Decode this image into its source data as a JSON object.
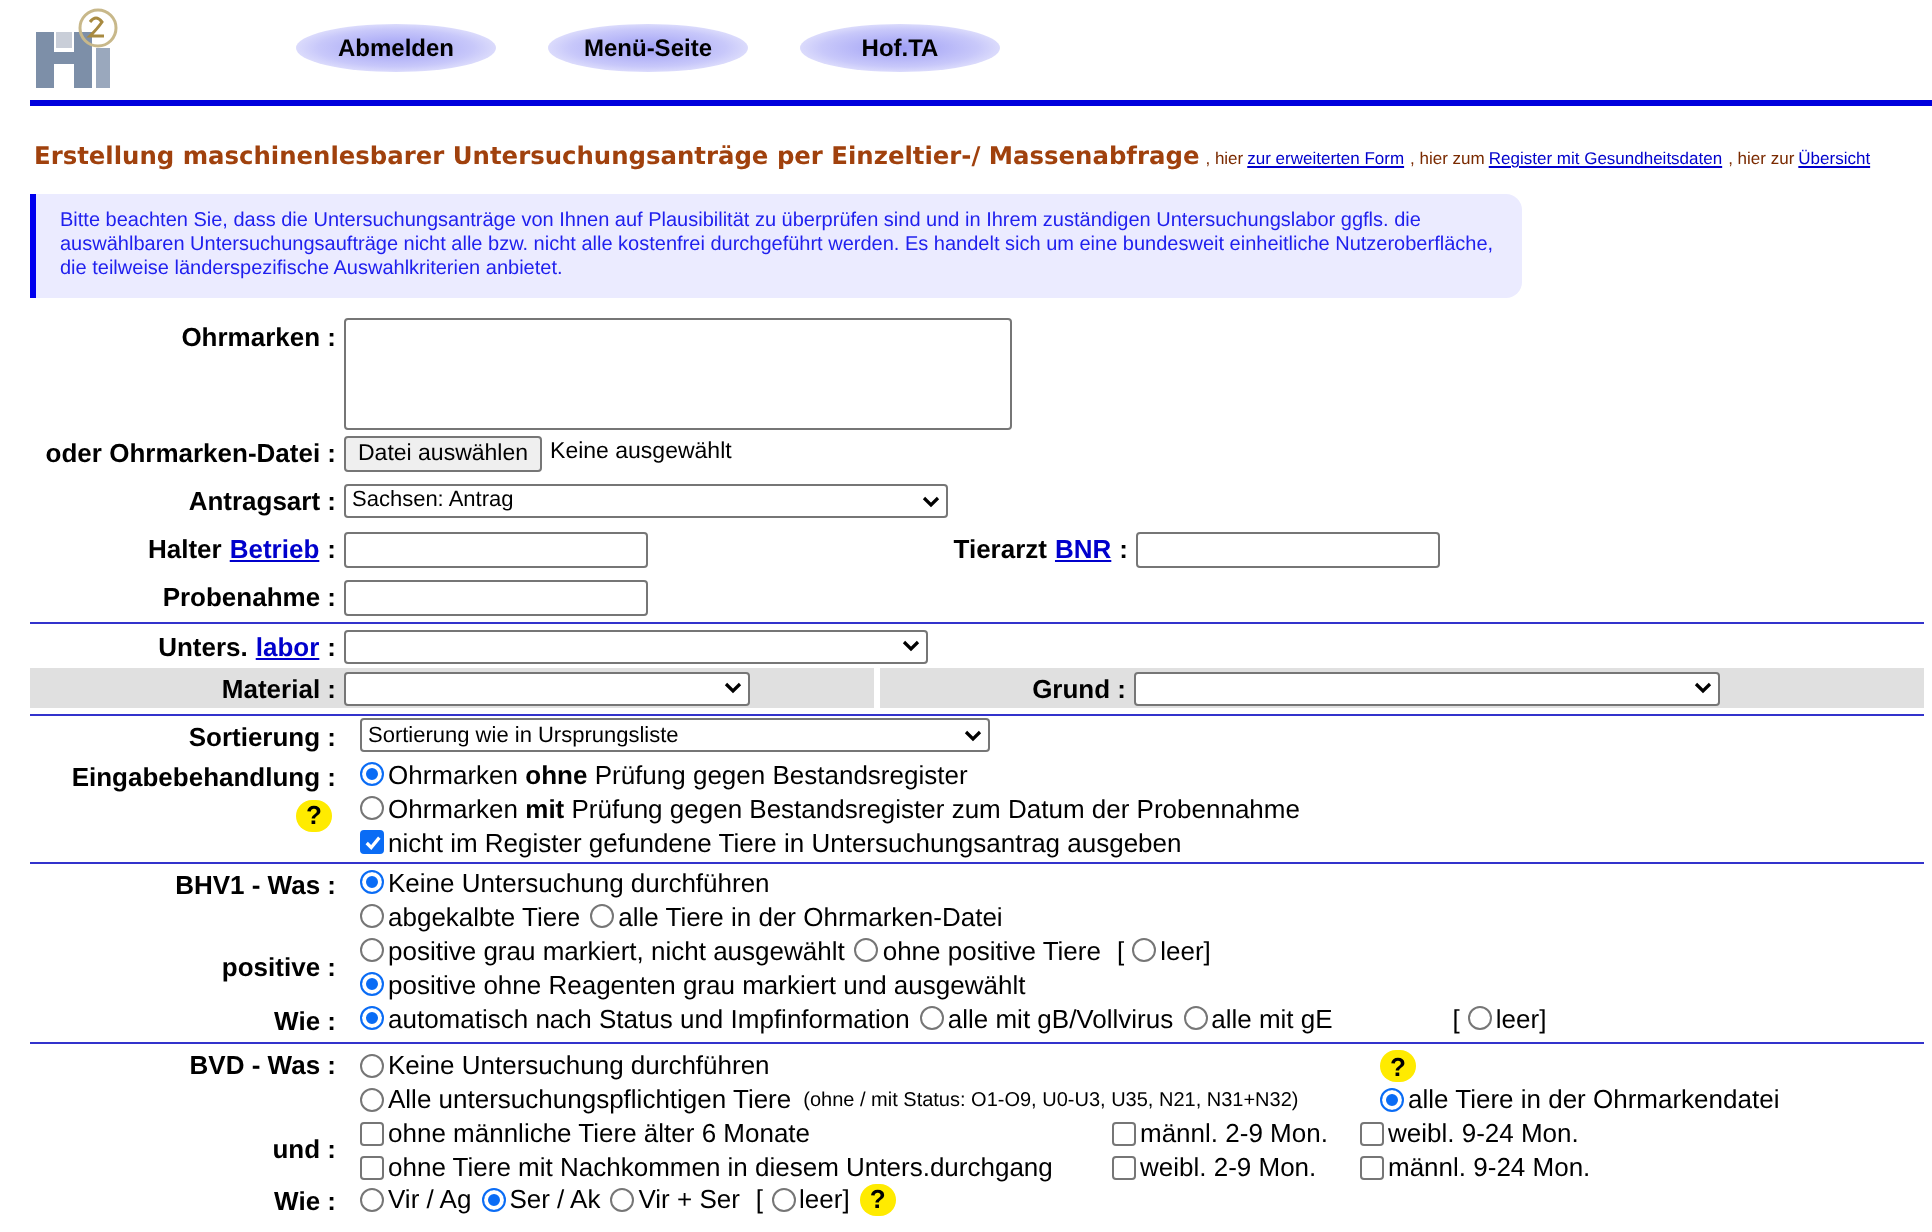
{
  "nav": [
    "Abmelden",
    "Menü-Seite",
    "Hof.TA"
  ],
  "title": "Erstellung maschinenlesbarer Untersuchungsanträge per Einzeltier-/ Massenabfrage",
  "title_links": [
    {
      "prefix": ", hier",
      "link": "zur erweiterten Form"
    },
    {
      "prefix": ", hier zum",
      "link": "Register mit Gesundheitsdaten"
    },
    {
      "prefix": ", hier zur",
      "link": "Übersicht"
    }
  ],
  "notice": "Bitte beachten Sie, dass die Untersuchungsanträge von Ihnen auf Plausibilität zu überprüfen sind und in Ihrem zuständigen Untersuchungslabor ggfls. die auswählbaren Untersuchungsaufträge nicht alle bzw. nicht alle kostenfrei durchgeführt werden. Es handelt sich um eine bundesweit einheitliche Nutzeroberfläche, die teilweise länderspezifische Auswahlkriterien anbietet.",
  "ohrmarken": {
    "label": "Ohrmarken :"
  },
  "datei": {
    "label": "oder Ohrmarken-Datei :",
    "button": "Datei auswählen",
    "status": "Keine ausgewählt"
  },
  "antragsart": {
    "label": "Antragsart :",
    "value": "Sachsen: Antrag"
  },
  "halter": {
    "label": "Halter",
    "link": "Betrieb",
    "suffix": ":"
  },
  "tierarzt": {
    "label": "Tierarzt",
    "link": "BNR",
    "suffix": ":"
  },
  "probenahme": {
    "label": "Probenahme :"
  },
  "labor": {
    "label": "Unters.",
    "link": "labor",
    "suffix": ":"
  },
  "material": {
    "label": "Material :"
  },
  "grund": {
    "label": "Grund :"
  },
  "sections": [
    {
      "rows": [
        {
          "kind": "group",
          "label": "Sortierung :",
          "lines": [
            {
              "kind": "flow",
              "items": [
                {
                  "kind": "select",
                  "label": "Sortierung wie in Ursprungsliste"
                }
              ]
            }
          ]
        },
        {
          "kind": "group",
          "label": "Eingabebehandlung :",
          "help": "?",
          "lines": [
            {
              "kind": "flow",
              "items": [
                {
                  "kind": "radio",
                  "label": "Ohrmarken **ohne** Prüfung gegen Bestandsregister",
                  "selected": true
                }
              ]
            },
            {
              "kind": "flow",
              "items": [
                {
                  "kind": "radio",
                  "label": "Ohrmarken **mit** Prüfung gegen Bestandsregister zum Datum der Probennahme",
                  "selected": false
                }
              ]
            },
            {
              "kind": "flow",
              "items": [
                {
                  "kind": "checkbox",
                  "label": "nicht im Register gefundene Tiere in Untersuchungsantrag ausgeben",
                  "checked": true
                }
              ]
            }
          ]
        }
      ]
    },
    {
      "rows": [
        {
          "kind": "group",
          "label": "BHV1 - Was :",
          "lines": [
            {
              "kind": "flow",
              "items": [
                {
                  "kind": "radio",
                  "label": "Keine Untersuchung durchführen",
                  "selected": true
                }
              ]
            },
            {
              "kind": "flow",
              "items": [
                {
                  "kind": "radio",
                  "label": "abgekalbte Tiere",
                  "selected": false
                },
                {
                  "kind": "radio",
                  "label": "alle Tiere in der Ohrmarken-Datei",
                  "selected": false
                }
              ]
            }
          ]
        },
        {
          "kind": "sub",
          "label": "positive :",
          "lines": [
            {
              "kind": "flow",
              "items": [
                {
                  "kind": "radio",
                  "label": "positive grau markiert, nicht ausgewählt",
                  "selected": false
                },
                {
                  "kind": "radio",
                  "label": "ohne positive Tiere",
                  "selected": false
                },
                {
                  "kind": "text",
                  "label": "["
                },
                {
                  "kind": "radio",
                  "label": "leer]",
                  "selected": false
                }
              ]
            },
            {
              "kind": "flow",
              "items": [
                {
                  "kind": "radio",
                  "label": "positive ohne Reagenten grau markiert und ausgewählt",
                  "selected": true
                }
              ]
            }
          ]
        },
        {
          "kind": "group",
          "label": "Wie :",
          "lines": [
            {
              "kind": "flow",
              "items": [
                {
                  "kind": "radio",
                  "label": "automatisch nach Status und Impfinformation",
                  "selected": true
                },
                {
                  "kind": "radio",
                  "label": "alle mit gB/Vollvirus",
                  "selected": false
                },
                {
                  "kind": "radio",
                  "label": "alle mit gE",
                  "selected": false
                },
                {
                  "kind": "gap"
                },
                {
                  "kind": "text",
                  "label": "["
                },
                {
                  "kind": "radio",
                  "label": "leer]",
                  "selected": false
                }
              ]
            }
          ]
        }
      ]
    },
    {
      "rows": [
        {
          "kind": "group",
          "label": "BVD - Was :",
          "lines": [
            {
              "kind": "split",
              "items": [
                {
                  "kind": "radio",
                  "label": "Keine Untersuchung durchführen",
                  "selected": false
                },
                {
                  "kind": "help",
                  "label": "?"
                }
              ]
            },
            {
              "kind": "split",
              "items": [
                {
                  "kind": "radio",
                  "label": "Alle untersuchungspflichtigen Tiere",
                  "note": "(ohne / mit Status: O1-O9, U0-U3, U35, N21, N31+N32)",
                  "selected": false
                },
                {
                  "kind": "radio",
                  "label": "alle Tiere in der Ohrmarkendatei",
                  "selected": true
                }
              ]
            }
          ]
        },
        {
          "kind": "sub",
          "label": "und :",
          "lines": [
            {
              "kind": "columns",
              "items": [
                {
                  "kind": "checkbox",
                  "label": "ohne männliche Tiere älter 6 Monate",
                  "checked": false
                },
                {
                  "kind": "checkbox",
                  "label": "männl. 2-9 Mon.",
                  "checked": false
                },
                {
                  "kind": "checkbox",
                  "label": "weibl. 9-24 Mon.",
                  "checked": false
                }
              ]
            },
            {
              "kind": "columns",
              "items": [
                {
                  "kind": "checkbox",
                  "label": "ohne Tiere mit Nachkommen in diesem Unters.durchgang",
                  "checked": false
                },
                {
                  "kind": "checkbox",
                  "label": "weibl. 2-9 Mon.",
                  "checked": false
                },
                {
                  "kind": "checkbox",
                  "label": "männl. 9-24 Mon.",
                  "checked": false
                }
              ]
            }
          ]
        },
        {
          "kind": "group",
          "label": "Wie :",
          "lines": [
            {
              "kind": "flow",
              "items": [
                {
                  "kind": "radio",
                  "label": "Vir / Ag",
                  "selected": false
                },
                {
                  "kind": "radio",
                  "label": "Ser / Ak",
                  "selected": true
                },
                {
                  "kind": "radio",
                  "label": "Vir + Ser",
                  "selected": false
                },
                {
                  "kind": "text",
                  "label": "["
                },
                {
                  "kind": "radio",
                  "label": "leer]",
                  "selected": false
                },
                {
                  "kind": "help",
                  "label": "?"
                }
              ]
            }
          ]
        }
      ]
    }
  ]
}
